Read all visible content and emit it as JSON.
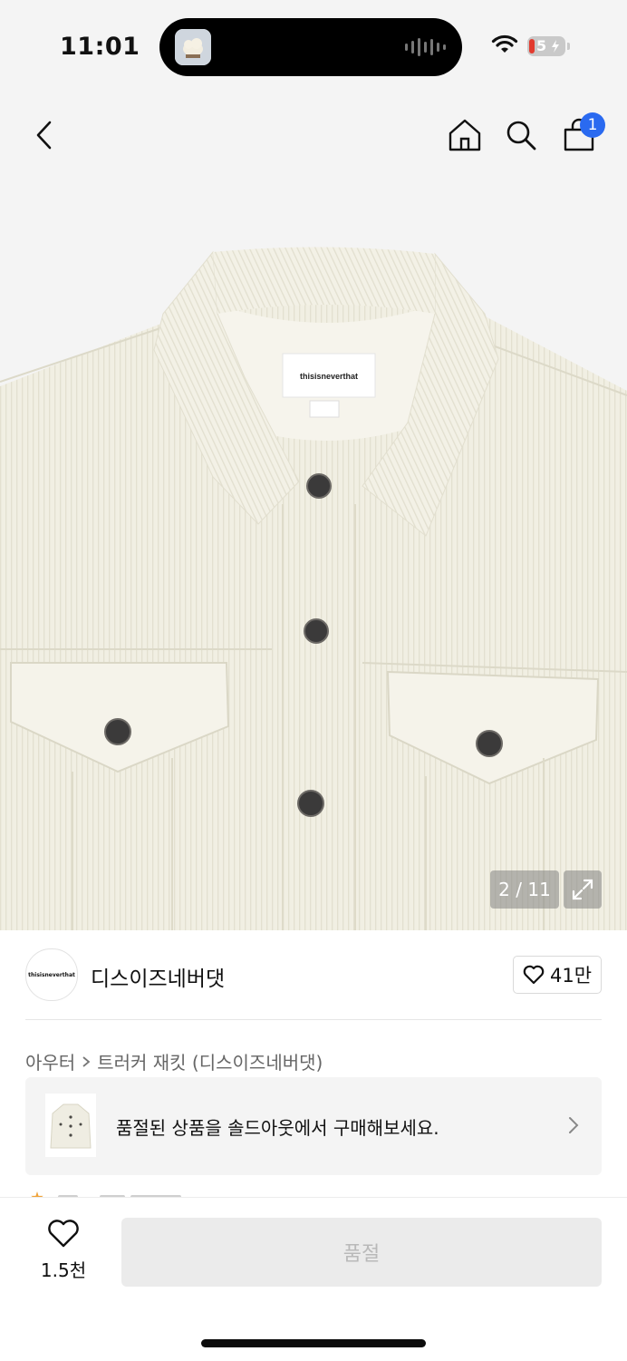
{
  "status_bar": {
    "time": "11:01",
    "battery_level": "5",
    "icons": [
      "wifi-icon",
      "battery-icon",
      "audio-wave-icon"
    ]
  },
  "nav": {
    "icons": [
      "back-icon",
      "home-icon",
      "search-icon",
      "bag-icon"
    ],
    "cart_badge": "1",
    "badge_color": "#2a6af0"
  },
  "gallery": {
    "image_label_text": "thisisneverthat",
    "counter": "2 / 11",
    "expand_icon": "expand-icon"
  },
  "brand": {
    "logo_text": "thisisneverthat",
    "name": "디스이즈네버댓",
    "like_count": "41만"
  },
  "breadcrumb": {
    "category": "아우터",
    "product": "트러커 재킷 (디스이즈네버댓)"
  },
  "soldout_banner": {
    "text": "품절된 상품을 솔드아웃에서 구매해보세요."
  },
  "bottom_bar": {
    "wish_count": "1.5천",
    "buy_label": "품절"
  }
}
